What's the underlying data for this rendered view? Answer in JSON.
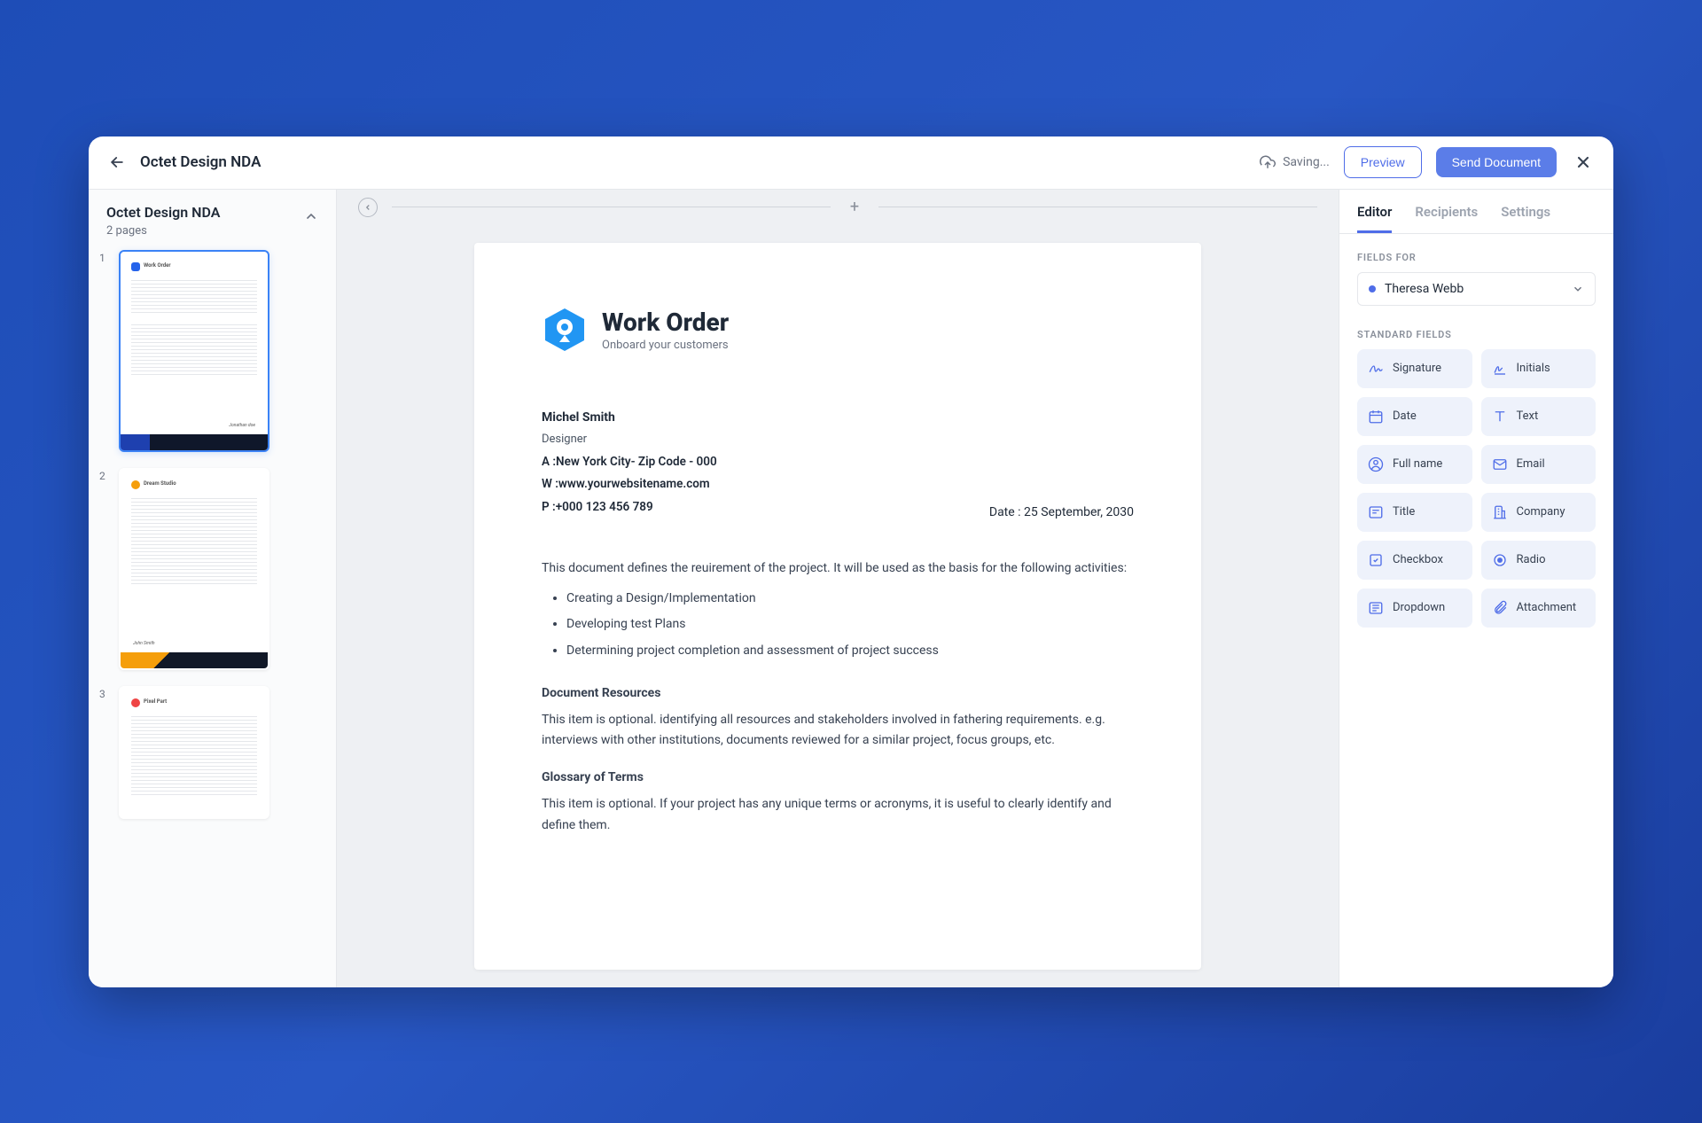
{
  "header": {
    "title": "Octet Design NDA",
    "saving": "Saving...",
    "preview": "Preview",
    "send": "Send Document"
  },
  "sidebar_left": {
    "title": "Octet Design NDA",
    "subtitle": "2 pages",
    "thumbnails": [
      {
        "num": "1",
        "active": true
      },
      {
        "num": "2",
        "active": false
      },
      {
        "num": "3",
        "active": false
      }
    ]
  },
  "document": {
    "logo_title": "Work Order",
    "logo_subtitle": "Onboard your customers",
    "name": "Michel Smith",
    "role": "Designer",
    "address": "A :New York City- Zip Code - 000",
    "website": "W :www.yourwebsitename.com",
    "phone": "P :+000 123 456 789",
    "date": "Date : 25 September, 2030",
    "intro": "This document defines the reuirement of the project. It will be used  as the basis for the following activities:",
    "bullets": [
      "Creating a Design/Implementation",
      "Developing test Plans",
      "Determining project completion and assessment of project success"
    ],
    "section1_title": "Document Resources",
    "section1_body": "This item is optional. identifying all resources and stakeholders involved in fathering requirements. e.g. interviews with other institutions, documents reviewed for a similar project, focus groups, etc.",
    "section2_title": "Glossary of Terms",
    "section2_body": "This item is optional. If your project has any unique terms or acronyms, it is useful to clearly identify and define them."
  },
  "sidebar_right": {
    "tabs": [
      "Editor",
      "Recipients",
      "Settings"
    ],
    "active_tab": 0,
    "fields_for_label": "FIELDS FOR",
    "selected_recipient": "Theresa Webb",
    "standard_fields_label": "STANDARD FIELDS",
    "fields": [
      {
        "icon": "signature",
        "label": "Signature"
      },
      {
        "icon": "initials",
        "label": "Initials"
      },
      {
        "icon": "date",
        "label": "Date"
      },
      {
        "icon": "text",
        "label": "Text"
      },
      {
        "icon": "fullname",
        "label": "Full name"
      },
      {
        "icon": "email",
        "label": "Email"
      },
      {
        "icon": "title",
        "label": "Title"
      },
      {
        "icon": "company",
        "label": "Company"
      },
      {
        "icon": "checkbox",
        "label": "Checkbox"
      },
      {
        "icon": "radio",
        "label": "Radio"
      },
      {
        "icon": "dropdown",
        "label": "Dropdown"
      },
      {
        "icon": "attachment",
        "label": "Attachment"
      }
    ]
  }
}
